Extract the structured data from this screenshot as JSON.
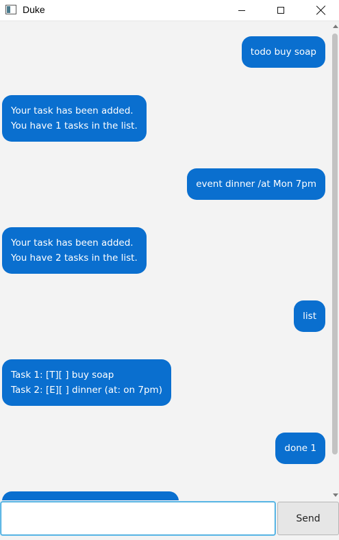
{
  "window": {
    "title": "Duke"
  },
  "chat": {
    "messages": [
      {
        "sender": "user",
        "lines": [
          "todo buy soap"
        ]
      },
      {
        "sender": "bot",
        "lines": [
          "Your task has been added.",
          "You have 1 tasks in the list."
        ]
      },
      {
        "sender": "user",
        "lines": [
          "event dinner /at Mon 7pm"
        ]
      },
      {
        "sender": "bot",
        "lines": [
          "Your task has been added.",
          "You have 2 tasks in the list."
        ]
      },
      {
        "sender": "user",
        "lines": [
          "list"
        ]
      },
      {
        "sender": "bot",
        "lines": [
          "Task 1: [T][ ] buy soap",
          "Task 2: [E][ ] dinner (at: on 7pm)"
        ]
      },
      {
        "sender": "user",
        "lines": [
          "done 1"
        ]
      },
      {
        "sender": "bot",
        "lines": [
          ""
        ]
      }
    ]
  },
  "input": {
    "value": "",
    "placeholder": ""
  },
  "send_button": {
    "label": "Send"
  },
  "colors": {
    "bubble": "#0a6fcf",
    "background": "#f3f3f3"
  }
}
